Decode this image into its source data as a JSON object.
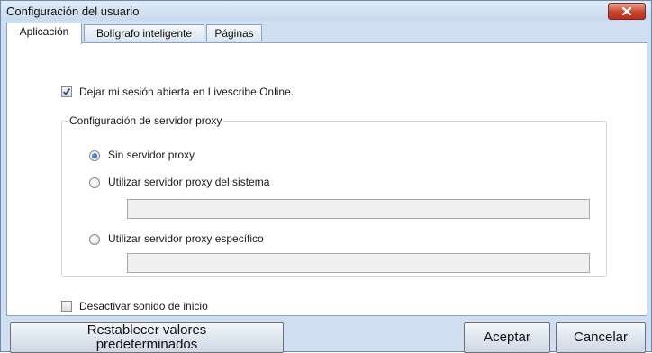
{
  "window": {
    "title": "Configuración del usuario"
  },
  "tabs": [
    {
      "label": "Aplicación",
      "active": true
    },
    {
      "label": "Bolígrafo inteligente",
      "active": false
    },
    {
      "label": "Páginas",
      "active": false
    }
  ],
  "application": {
    "stay_logged_in": {
      "label": "Dejar mi sesión abierta en Livescribe Online.",
      "checked": true
    },
    "proxy_group": {
      "title": "Configuración de servidor proxy",
      "options": [
        {
          "label": "Sin servidor proxy",
          "selected": true
        },
        {
          "label": "Utilizar servidor proxy del sistema",
          "selected": false
        },
        {
          "label": "Utilizar servidor proxy específico",
          "selected": false
        }
      ],
      "system_proxy_value": "",
      "specific_proxy_value": ""
    },
    "disable_startup_sound": {
      "label": "Desactivar sonido de inicio",
      "checked": false
    }
  },
  "buttons": {
    "reset_line1": "Restablecer valores",
    "reset_line2": "predeterminados",
    "accept": "Aceptar",
    "cancel": "Cancelar"
  },
  "icons": {
    "close": "close-icon",
    "check": "checkmark-icon"
  }
}
